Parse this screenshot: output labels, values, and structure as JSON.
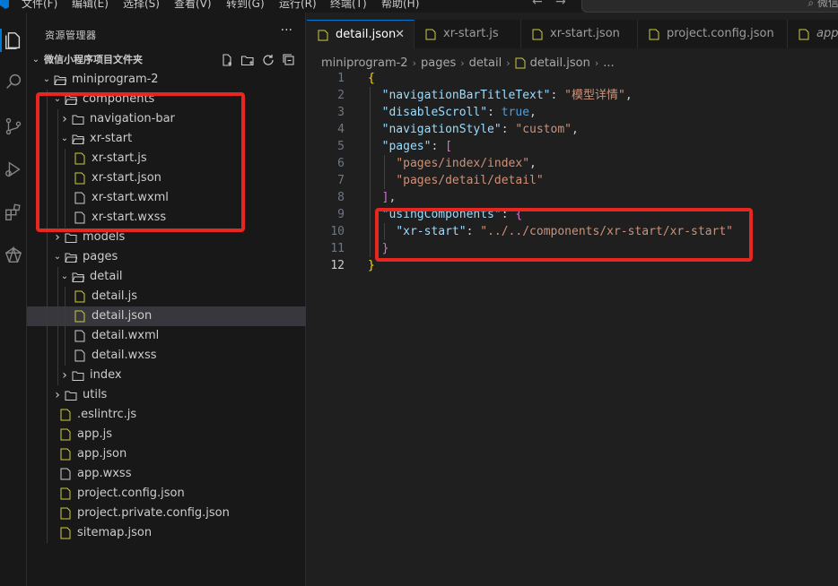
{
  "menubar": {
    "items": [
      "文件(F)",
      "编辑(E)",
      "选择(S)",
      "查看(V)",
      "转到(G)",
      "运行(R)",
      "终端(T)",
      "帮助(H)"
    ],
    "search_text": "微信小"
  },
  "colors": {
    "accent": "#0078d4",
    "highlight_box": "#e8251e",
    "json_icon": "#cbcb41",
    "js_icon": "#cbcb41"
  },
  "activity_bar": {
    "items": [
      "explorer-icon",
      "search-icon",
      "source-control-icon",
      "run-debug-icon",
      "extensions-icon",
      "wechat-devtools-icon"
    ]
  },
  "sidebar": {
    "title": "资源管理器",
    "more": "···",
    "root_label": "微信小程序项目文件夹",
    "tree": [
      {
        "label": "miniprogram-2",
        "type": "folder",
        "open": true
      },
      {
        "label": "components",
        "type": "folder",
        "open": true
      },
      {
        "label": "navigation-bar",
        "type": "folder",
        "open": false
      },
      {
        "label": "xr-start",
        "type": "folder",
        "open": true
      },
      {
        "label": "xr-start.js",
        "type": "js"
      },
      {
        "label": "xr-start.json",
        "type": "json"
      },
      {
        "label": "xr-start.wxml",
        "type": "file"
      },
      {
        "label": "xr-start.wxss",
        "type": "file"
      },
      {
        "label": "models",
        "type": "folder",
        "open": false
      },
      {
        "label": "pages",
        "type": "folder",
        "open": true
      },
      {
        "label": "detail",
        "type": "folder",
        "open": true
      },
      {
        "label": "detail.js",
        "type": "js"
      },
      {
        "label": "detail.json",
        "type": "json"
      },
      {
        "label": "detail.wxml",
        "type": "file"
      },
      {
        "label": "detail.wxss",
        "type": "file"
      },
      {
        "label": "index",
        "type": "folder",
        "open": false
      },
      {
        "label": "utils",
        "type": "folder",
        "open": false
      },
      {
        "label": ".eslintrc.js",
        "type": "js"
      },
      {
        "label": "app.js",
        "type": "js"
      },
      {
        "label": "app.json",
        "type": "json"
      },
      {
        "label": "app.wxss",
        "type": "file"
      },
      {
        "label": "project.config.json",
        "type": "json"
      },
      {
        "label": "project.private.config.json",
        "type": "json"
      },
      {
        "label": "sitemap.json",
        "type": "json"
      }
    ]
  },
  "tabs": [
    {
      "label": "detail.json",
      "close": "✕"
    },
    {
      "label": "xr-start.js"
    },
    {
      "label": "xr-start.json"
    },
    {
      "label": "project.config.json"
    },
    {
      "label": "app.j"
    }
  ],
  "breadcrumb": [
    "miniprogram-2",
    "pages",
    "detail",
    "detail.json",
    "..."
  ],
  "code": {
    "line_numbers": [
      "1",
      "2",
      "3",
      "4",
      "5",
      "6",
      "7",
      "8",
      "9",
      "10",
      "11",
      "12"
    ],
    "lines": [
      [
        {
          "t": "{",
          "c": "br1"
        }
      ],
      [
        {
          "t": "  "
        },
        {
          "t": "\"navigationBarTitleText\"",
          "c": "k"
        },
        {
          "t": ": ",
          "c": "p"
        },
        {
          "t": "\"模型详情\"",
          "c": "s"
        },
        {
          "t": ",",
          "c": "p"
        }
      ],
      [
        {
          "t": "  "
        },
        {
          "t": "\"disableScroll\"",
          "c": "k"
        },
        {
          "t": ": ",
          "c": "p"
        },
        {
          "t": "true",
          "c": "b"
        },
        {
          "t": ",",
          "c": "p"
        }
      ],
      [
        {
          "t": "  "
        },
        {
          "t": "\"navigationStyle\"",
          "c": "k"
        },
        {
          "t": ": ",
          "c": "p"
        },
        {
          "t": "\"custom\"",
          "c": "s"
        },
        {
          "t": ",",
          "c": "p"
        }
      ],
      [
        {
          "t": "  "
        },
        {
          "t": "\"pages\"",
          "c": "k"
        },
        {
          "t": ": ",
          "c": "p"
        },
        {
          "t": "[",
          "c": "br2"
        }
      ],
      [
        {
          "t": "    "
        },
        {
          "t": "\"pages/index/index\"",
          "c": "s"
        },
        {
          "t": ",",
          "c": "p"
        }
      ],
      [
        {
          "t": "    "
        },
        {
          "t": "\"pages/detail/detail\"",
          "c": "s"
        }
      ],
      [
        {
          "t": "  "
        },
        {
          "t": "]",
          "c": "br2"
        },
        {
          "t": ",",
          "c": "p"
        }
      ],
      [
        {
          "t": "  "
        },
        {
          "t": "\"usingComponents\"",
          "c": "k"
        },
        {
          "t": ": ",
          "c": "p"
        },
        {
          "t": "{",
          "c": "br2"
        }
      ],
      [
        {
          "t": "    "
        },
        {
          "t": "\"xr-start\"",
          "c": "k"
        },
        {
          "t": ": ",
          "c": "p"
        },
        {
          "t": "\"../../components/xr-start/xr-start\"",
          "c": "s"
        }
      ],
      [
        {
          "t": "  "
        },
        {
          "t": "}",
          "c": "br2"
        }
      ],
      [
        {
          "t": "}",
          "c": "br1"
        }
      ]
    ],
    "current_line": 12
  }
}
